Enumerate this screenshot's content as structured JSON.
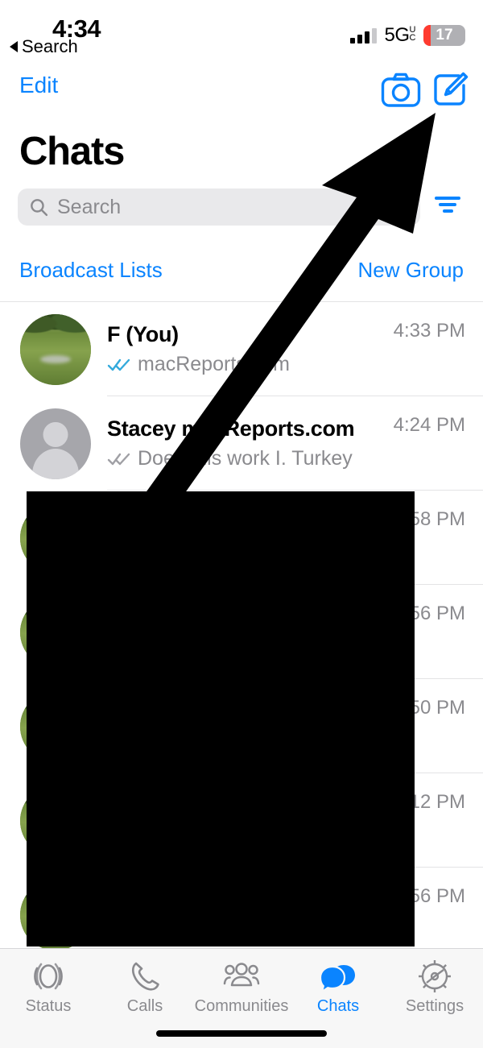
{
  "status_bar": {
    "time": "4:34",
    "back_label": "Search",
    "back_icon": "back-triangle-icon",
    "signal_icon": "cellular-signal-icon",
    "network_label": "5G",
    "network_sub_top": "U",
    "network_sub_bottom": "C",
    "battery_level": "17",
    "battery_percent": 17,
    "battery_color": "#ff3b30"
  },
  "nav_bar": {
    "edit_label": "Edit",
    "camera_icon": "camera-icon",
    "compose_icon": "compose-icon",
    "accent_color": "#0a84ff"
  },
  "header": {
    "title": "Chats"
  },
  "search": {
    "placeholder": "Search",
    "value": "",
    "search_icon": "search-icon",
    "filter_icon": "filter-icon"
  },
  "actions": {
    "broadcast_lists_label": "Broadcast Lists",
    "new_group_label": "New Group"
  },
  "chats": [
    {
      "name": "F (You)",
      "preview": "macReports.com",
      "time": "4:33 PM",
      "ticks": "double-check-read-icon",
      "ticks_color": "#34aadc",
      "avatar": "photo-nature-avatar",
      "redacted": false
    },
    {
      "name": "Stacey macReports.com",
      "preview": "Does this work I. Turkey",
      "time": "4:24 PM",
      "ticks": "double-check-delivered-icon",
      "ticks_color": "#a0a0a5",
      "avatar": "default-person-avatar",
      "redacted": false
    },
    {
      "name": "",
      "preview": "",
      "time": "58 PM",
      "ticks": "",
      "ticks_color": "",
      "avatar": "photo-avatar",
      "redacted": true
    },
    {
      "name": "",
      "preview": "",
      "time": "56 PM",
      "ticks": "",
      "ticks_color": "",
      "avatar": "photo-avatar",
      "redacted": true
    },
    {
      "name": "",
      "preview": "",
      "time": "50 PM",
      "ticks": "",
      "ticks_color": "",
      "avatar": "photo-avatar",
      "redacted": true
    },
    {
      "name": "",
      "preview": "",
      "time": ":12 PM",
      "ticks": "",
      "ticks_color": "",
      "avatar": "photo-avatar",
      "redacted": true
    },
    {
      "name": "",
      "preview": "",
      "time": "56 PM",
      "ticks": "",
      "ticks_color": "",
      "avatar": "photo-avatar",
      "redacted": true
    }
  ],
  "overlay": {
    "redaction_box": "black-redaction-box",
    "pointer": "mouse-pointer-arrow"
  },
  "tab_bar": {
    "active_index": 3,
    "items": [
      {
        "label": "Status",
        "icon": "status-rings-icon"
      },
      {
        "label": "Calls",
        "icon": "phone-handset-icon"
      },
      {
        "label": "Communities",
        "icon": "communities-people-icon"
      },
      {
        "label": "Chats",
        "icon": "chat-bubbles-icon"
      },
      {
        "label": "Settings",
        "icon": "gear-icon"
      }
    ]
  }
}
